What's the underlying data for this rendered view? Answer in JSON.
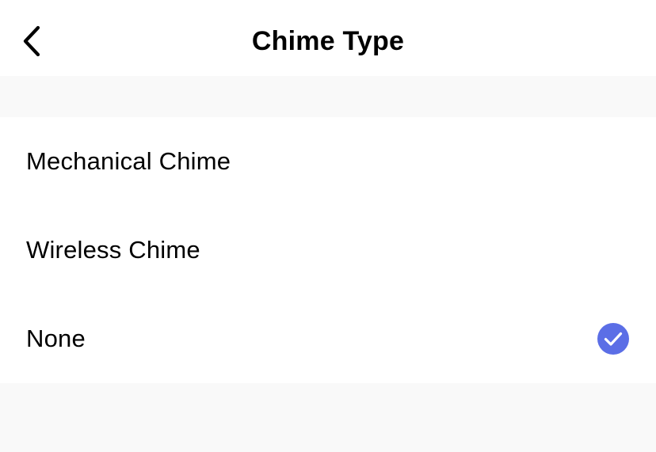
{
  "header": {
    "back_icon": "chevron-left-icon",
    "title": "Chime Type"
  },
  "options": [
    {
      "label": "Mechanical Chime",
      "selected": false
    },
    {
      "label": "Wireless Chime",
      "selected": false
    },
    {
      "label": "None",
      "selected": true
    }
  ],
  "selected_icon": "check-circle-icon",
  "colors": {
    "accent": "#5b6ee6",
    "background": "#f9f9f9",
    "surface": "#ffffff",
    "text": "#000000"
  }
}
